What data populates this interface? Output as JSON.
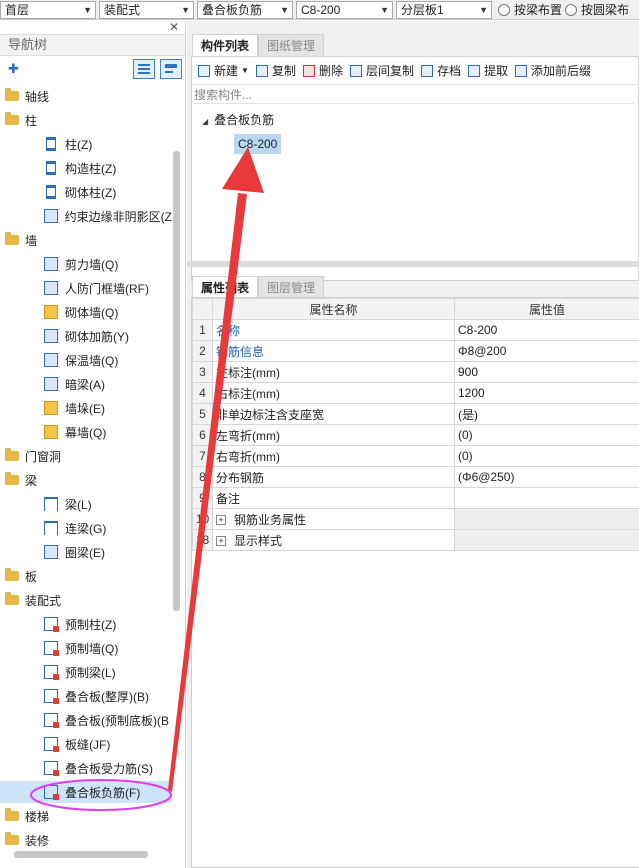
{
  "topbar": {
    "floor": "首层",
    "type": "装配式",
    "category": "叠合板负筋",
    "component": "C8-200",
    "layer": "分层板1",
    "radio1": "按梁布置",
    "radio2": "按圆梁布"
  },
  "nav": {
    "title": "导航树",
    "tree": [
      {
        "kind": "cat",
        "label": "轴线"
      },
      {
        "kind": "cat",
        "label": "柱"
      },
      {
        "kind": "item",
        "icon": "column-icon",
        "label": "柱(Z)"
      },
      {
        "kind": "item",
        "icon": "column-icon",
        "label": "构造柱(Z)"
      },
      {
        "kind": "item",
        "icon": "column-icon",
        "label": "砌体柱(Z)"
      },
      {
        "kind": "item",
        "icon": "wall-icon",
        "label": "约束边缘非阴影区(Z"
      },
      {
        "kind": "cat",
        "label": "墙"
      },
      {
        "kind": "item",
        "icon": "wall-icon",
        "label": "剪力墙(Q)"
      },
      {
        "kind": "item",
        "icon": "wall-icon",
        "label": "人防门框墙(RF)"
      },
      {
        "kind": "item",
        "icon": "brick-icon",
        "label": "砌体墙(Q)"
      },
      {
        "kind": "item",
        "icon": "wall-icon",
        "label": "砌体加筋(Y)"
      },
      {
        "kind": "item",
        "icon": "wall-icon",
        "label": "保温墙(Q)"
      },
      {
        "kind": "item",
        "icon": "wall-icon",
        "label": "暗梁(A)"
      },
      {
        "kind": "item",
        "icon": "brick-icon",
        "label": "墙垛(E)"
      },
      {
        "kind": "item",
        "icon": "brick-icon",
        "label": "幕墙(Q)"
      },
      {
        "kind": "cat",
        "label": "门窗洞"
      },
      {
        "kind": "cat",
        "label": "梁"
      },
      {
        "kind": "item",
        "icon": "beam-icon",
        "label": "梁(L)"
      },
      {
        "kind": "item",
        "icon": "beam-icon",
        "label": "连梁(G)"
      },
      {
        "kind": "item",
        "icon": "wall-icon",
        "label": "圈梁(E)"
      },
      {
        "kind": "cat",
        "label": "板"
      },
      {
        "kind": "cat",
        "label": "装配式"
      },
      {
        "kind": "item",
        "icon": "precast-icon",
        "label": "预制柱(Z)"
      },
      {
        "kind": "item",
        "icon": "precast-icon",
        "label": "预制墙(Q)"
      },
      {
        "kind": "item",
        "icon": "precast-icon",
        "label": "预制梁(L)"
      },
      {
        "kind": "item",
        "icon": "precast-icon",
        "label": "叠合板(整厚)(B)"
      },
      {
        "kind": "item",
        "icon": "precast-icon",
        "label": "叠合板(预制底板)(B"
      },
      {
        "kind": "item",
        "icon": "precast-icon",
        "label": "板缝(JF)"
      },
      {
        "kind": "item",
        "icon": "precast-icon",
        "label": "叠合板受力筋(S)"
      },
      {
        "kind": "item",
        "icon": "precast-icon",
        "label": "叠合板负筋(F)",
        "selected": true
      },
      {
        "kind": "cat",
        "label": "楼梯"
      },
      {
        "kind": "cat",
        "label": "装修"
      }
    ]
  },
  "components": {
    "tab_active": "构件列表",
    "tab_inactive": "图纸管理",
    "toolbar": {
      "new": "新建",
      "copy": "复制",
      "delete": "删除",
      "floor_copy": "层间复制",
      "save": "存档",
      "extract": "提取",
      "add_prefix": "添加前后缀"
    },
    "search_placeholder": "搜索构件...",
    "root": "叠合板负筋",
    "selected_item": "C8-200"
  },
  "properties": {
    "tab_active": "属性列表",
    "tab_inactive": "图层管理",
    "header_name": "属性名称",
    "header_value": "属性值",
    "rows": [
      {
        "num": "1",
        "name": "名称",
        "value": "C8-200",
        "blue": true
      },
      {
        "num": "2",
        "name": "钢筋信息",
        "value": "Φ8@200",
        "blue": true
      },
      {
        "num": "3",
        "name": "左标注(mm)",
        "value": "900"
      },
      {
        "num": "4",
        "name": "右标注(mm)",
        "value": "1200"
      },
      {
        "num": "5",
        "name": "非单边标注含支座宽",
        "value": "(是)"
      },
      {
        "num": "6",
        "name": "左弯折(mm)",
        "value": "(0)"
      },
      {
        "num": "7",
        "name": "右弯折(mm)",
        "value": "(0)"
      },
      {
        "num": "8",
        "name": "分布钢筋",
        "value": "(Φ6@250)"
      },
      {
        "num": "9",
        "name": "备注",
        "value": ""
      },
      {
        "num": "10",
        "name": "钢筋业务属性",
        "value": "",
        "expand": true
      },
      {
        "num": "18",
        "name": "显示样式",
        "value": "",
        "expand": true
      }
    ]
  },
  "colors": {
    "accent_blue": "#2d6db5",
    "selection": "#b9d6f3",
    "annotation_red": "#e83a3a",
    "annotation_magenta": "#e23cf0"
  }
}
